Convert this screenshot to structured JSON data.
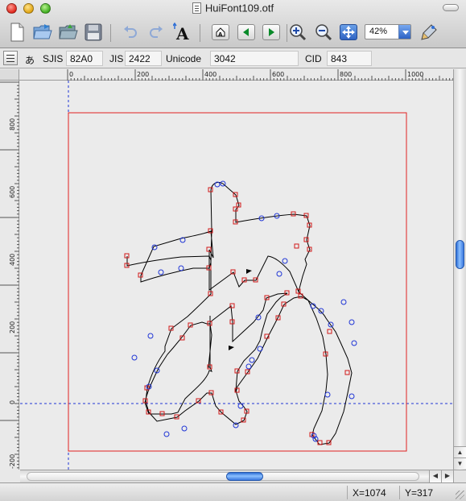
{
  "window": {
    "title": "HuiFont109.otf"
  },
  "toolbar": {
    "zoom_value": "42%",
    "icons": [
      "new-document-icon",
      "open-folder-icon",
      "open-recent-icon",
      "save-disk-icon",
      "undo-icon",
      "redo-icon",
      "glyph-text-icon",
      "home-glyph-icon",
      "previous-glyph-icon",
      "next-glyph-icon",
      "zoom-in-icon",
      "zoom-out-icon",
      "fit-view-icon",
      "palette-icon"
    ]
  },
  "glyph_info": {
    "kana": "あ",
    "sjis_label": "SJIS",
    "sjis_value": "82A0",
    "jis_label": "JIS",
    "jis_value": "2422",
    "unicode_label": "Unicode",
    "unicode_value": "3042",
    "cid_label": "CID",
    "cid_value": "843"
  },
  "rulers": {
    "top": [
      "0",
      "200",
      "400",
      "600",
      "800",
      "1000"
    ],
    "left": [
      "800",
      "600",
      "400",
      "200",
      "0",
      "-200"
    ]
  },
  "colors": {
    "em_box": "#e02020",
    "outline": "#000000",
    "on_curve_point": "#d01818",
    "off_curve_point": "#1f35d6",
    "guide": "#1f35d6",
    "accent": "#2f6fd6"
  },
  "status": {
    "x": "X=1074",
    "y": "Y=317"
  }
}
